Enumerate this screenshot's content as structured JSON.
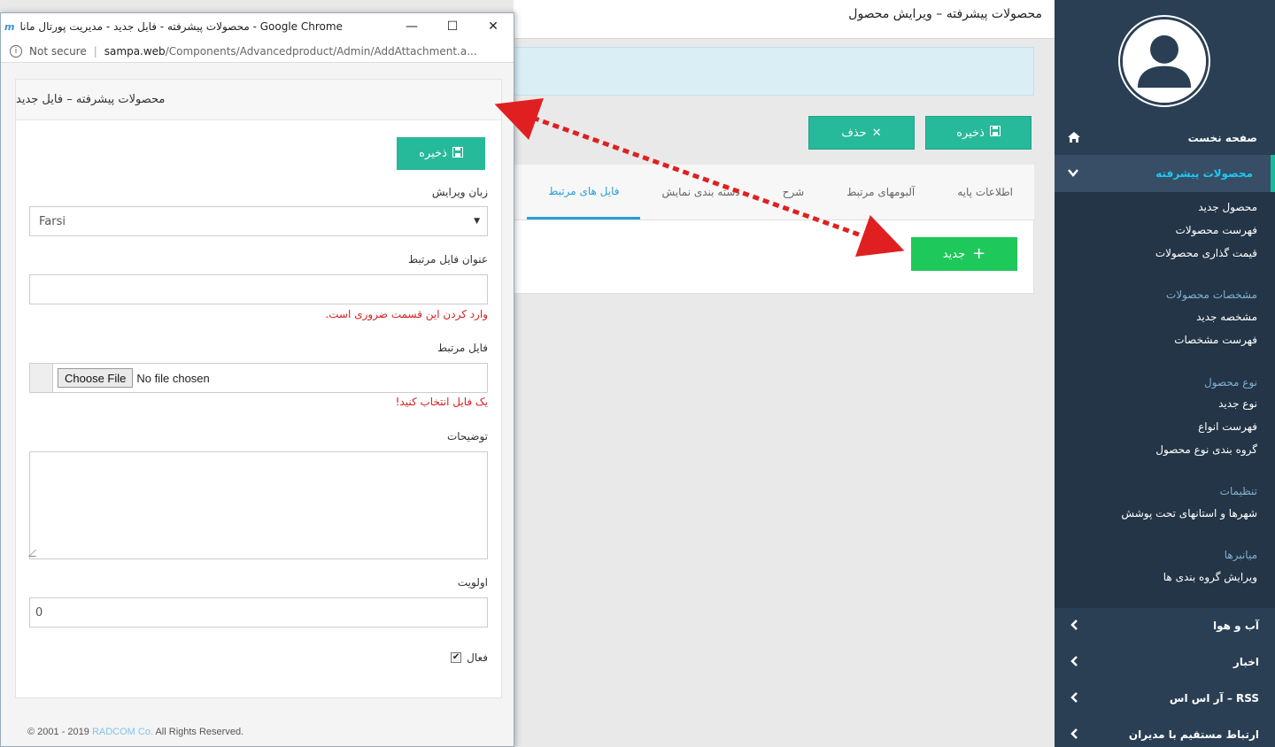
{
  "page": {
    "title": "محصولات پیشرفته – ویرایش محصول",
    "save_label": "ذخیره",
    "delete_label": "حذف",
    "new_label": "جدید",
    "tabs": [
      "اطلاعات پایه",
      "آلبومهای مرتبط",
      "شرح",
      "دسته بندی نمایش",
      "فایل های مرتبط"
    ],
    "active_tab": "فایل های مرتبط"
  },
  "sidebar": {
    "home": "صفحه نخست",
    "advanced_products": "محصولات پیشرفته",
    "submenu": {
      "new_product": "محصول جدید",
      "product_list": "فهرست محصولات",
      "product_pricing": "قیمت گذاری محصولات",
      "specs_head": "مشخصات محصولات",
      "new_spec": "مشخصه جدید",
      "spec_list": "فهرست مشخصات",
      "type_head": "نوع محصول",
      "new_type": "نوع جدید",
      "type_list": "فهرست انواع",
      "type_group": "گروه بندی نوع محصول",
      "settings_head": "تنظیمات",
      "cities": "شهرها و استانهای تحت پوشش",
      "shortcuts_head": "میانبرها",
      "edit_groups": "ویرایش گروه بندی ها"
    },
    "weather": "آب و هوا",
    "news": "اخبار",
    "rss": "آر اس اس – RSS",
    "contact_admins": "ارتباط مستقیم با مدیران"
  },
  "popup": {
    "window_title": "محصولات پیشرفته - فایل جدید - مدیریت پورتال مانا - Google Chrome",
    "not_secure": "Not secure",
    "url_host": "sampa.web",
    "url_path": "/Components/Advancedproduct/Admin/AddAttachment.a...",
    "panel_title": "محصولات پیشرفته – فایل جدید",
    "save_label": "ذخیره",
    "language_label": "زبان ویرایش",
    "language_value": "Farsi",
    "file_title_label": "عنوان فایل مرتبط",
    "file_title_value": "",
    "required_error": "وارد کردن این قسمت ضروری است.",
    "file_label": "فایل مرتبط",
    "choose_file": "Choose File",
    "no_file": "No file chosen",
    "file_error": "یک فایل انتخاب کنید!",
    "description_label": "توضیحات",
    "priority_label": "اولویت",
    "priority_value": "0",
    "active_label": "فعال",
    "active_checked": true,
    "copyright_prefix": "© 2001 - 2019",
    "copyright_brand": "RADCOM Co.",
    "copyright_suffix": "All Rights Reserved."
  },
  "colors": {
    "teal_button": "#26b99a",
    "green_button": "#1ec85a",
    "sidebar_bg": "#2a3f54",
    "active_tab": "#26a0da",
    "error_text": "#d62020",
    "annotation_arrow": "#e02020"
  }
}
